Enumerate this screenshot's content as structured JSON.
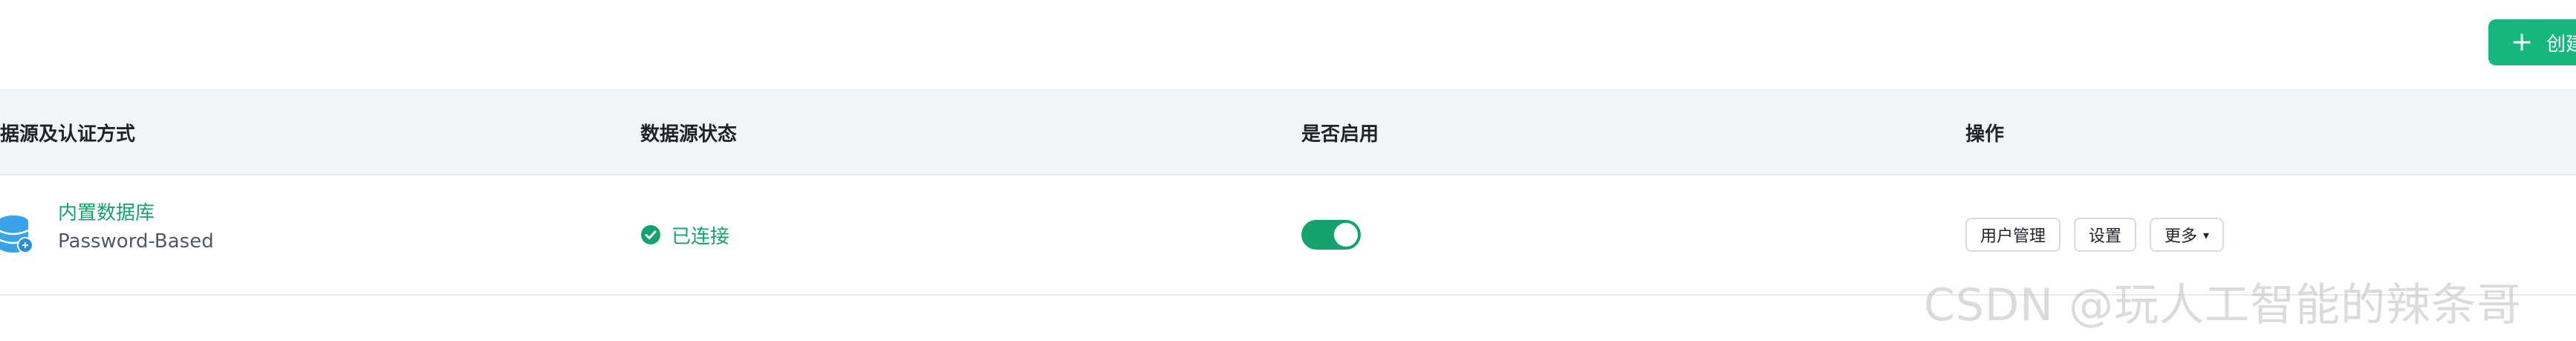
{
  "toolbar": {
    "create_label": "创建",
    "create_icon": "plus-icon"
  },
  "table": {
    "columns": [
      "据源及认证方式",
      "数据源状态",
      "是否启用",
      "操作"
    ],
    "rows": [
      {
        "icon": "database-icon",
        "name": "内置数据库",
        "auth": "Password-Based",
        "status_icon": "check-circle-icon",
        "status": "已连接",
        "enabled": true,
        "actions": [
          "用户管理",
          "设置",
          "更多"
        ]
      }
    ]
  },
  "watermark": "CSDN @玩人工智能的辣条哥",
  "colors": {
    "accent": "#15b77e",
    "status_green": "#14a36f",
    "header_bg": "#f3f5f6",
    "db_icon_blue": "#3aa3e8"
  }
}
